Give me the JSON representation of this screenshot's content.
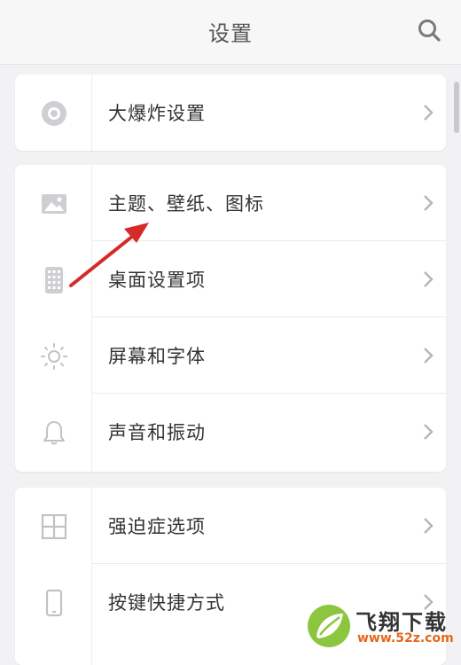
{
  "header": {
    "title": "设置"
  },
  "groups": [
    {
      "items": [
        {
          "label": "大爆炸设置",
          "icon": "gear-dot-icon"
        }
      ]
    },
    {
      "items": [
        {
          "label": "主题、壁纸、图标",
          "icon": "image-icon"
        },
        {
          "label": "桌面设置项",
          "icon": "grid-phone-icon"
        },
        {
          "label": "屏幕和字体",
          "icon": "sun-icon"
        },
        {
          "label": "声音和振动",
          "icon": "bell-icon"
        }
      ]
    },
    {
      "items": [
        {
          "label": "强迫症选项",
          "icon": "window-grid-icon"
        },
        {
          "label": "按键快捷方式",
          "icon": "phone-icon"
        }
      ]
    }
  ],
  "watermark": {
    "title": "飞翔下载",
    "url": "www.52z.com"
  },
  "colors": {
    "arrow": "#d42a2a",
    "chevron": "#b5b5b8",
    "icon": "#c8c8cc"
  }
}
